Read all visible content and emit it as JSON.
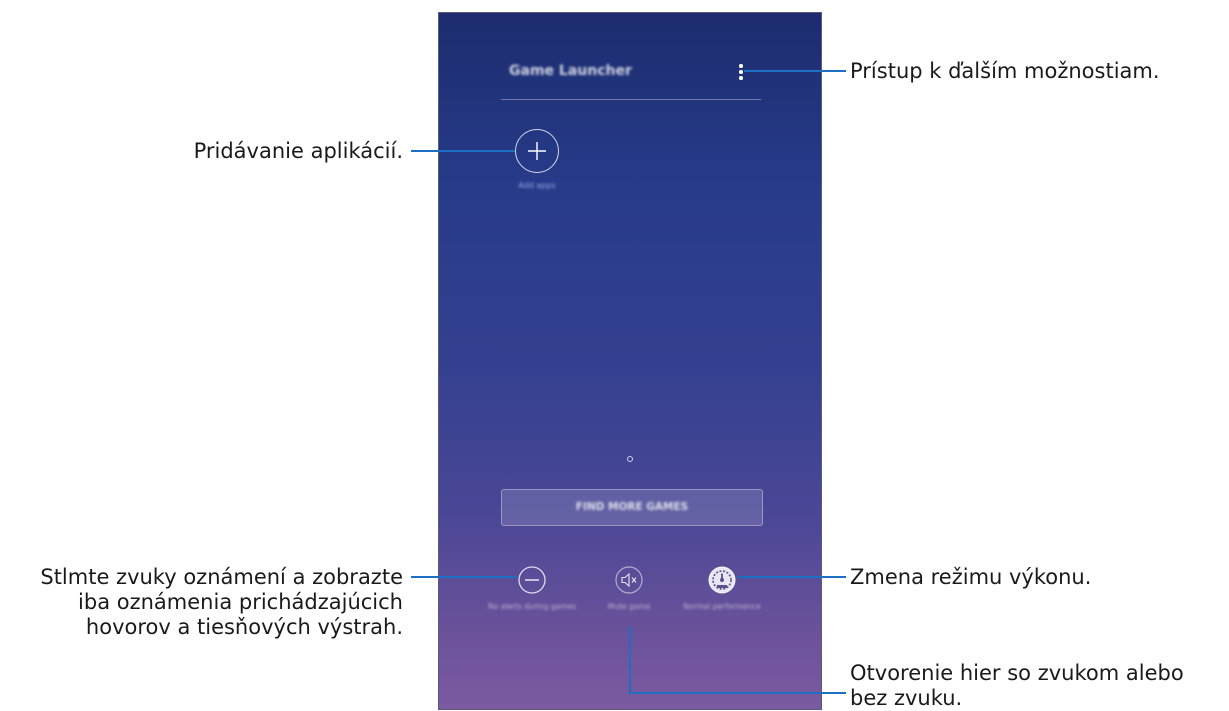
{
  "screen": {
    "app_title": "Game Launcher",
    "more_options_icon": "more-vertical-icon",
    "add_apps": {
      "icon": "plus-circle-icon",
      "label": "Add apps"
    },
    "find_more_games_label": "FIND MORE GAMES",
    "quick_actions": [
      {
        "icon": "minus-circle-icon",
        "label": "No alerts during games"
      },
      {
        "icon": "mute-icon",
        "label": "Mute game"
      },
      {
        "icon": "speedometer-icon",
        "label": "Normal performance"
      }
    ]
  },
  "callouts": {
    "more_options": "Prístup k ďalším možnostiam.",
    "add_apps": "Pridávanie aplikácií.",
    "no_alerts_line1": "Stlmte zvuky oznámení a zobrazte",
    "no_alerts_line2": "iba oznámenia prichádzajúcich",
    "no_alerts_line3": "hovorov a tiesňových výstrah.",
    "performance": "Zmena režimu výkonu.",
    "mute_line1": "Otvorenie hier so zvukom alebo",
    "mute_line2": "bez zvuku."
  },
  "colors": {
    "leader_line": "#1d6fc4",
    "screen_top": "#1c2c6e",
    "screen_bottom": "#7b5aa0"
  }
}
